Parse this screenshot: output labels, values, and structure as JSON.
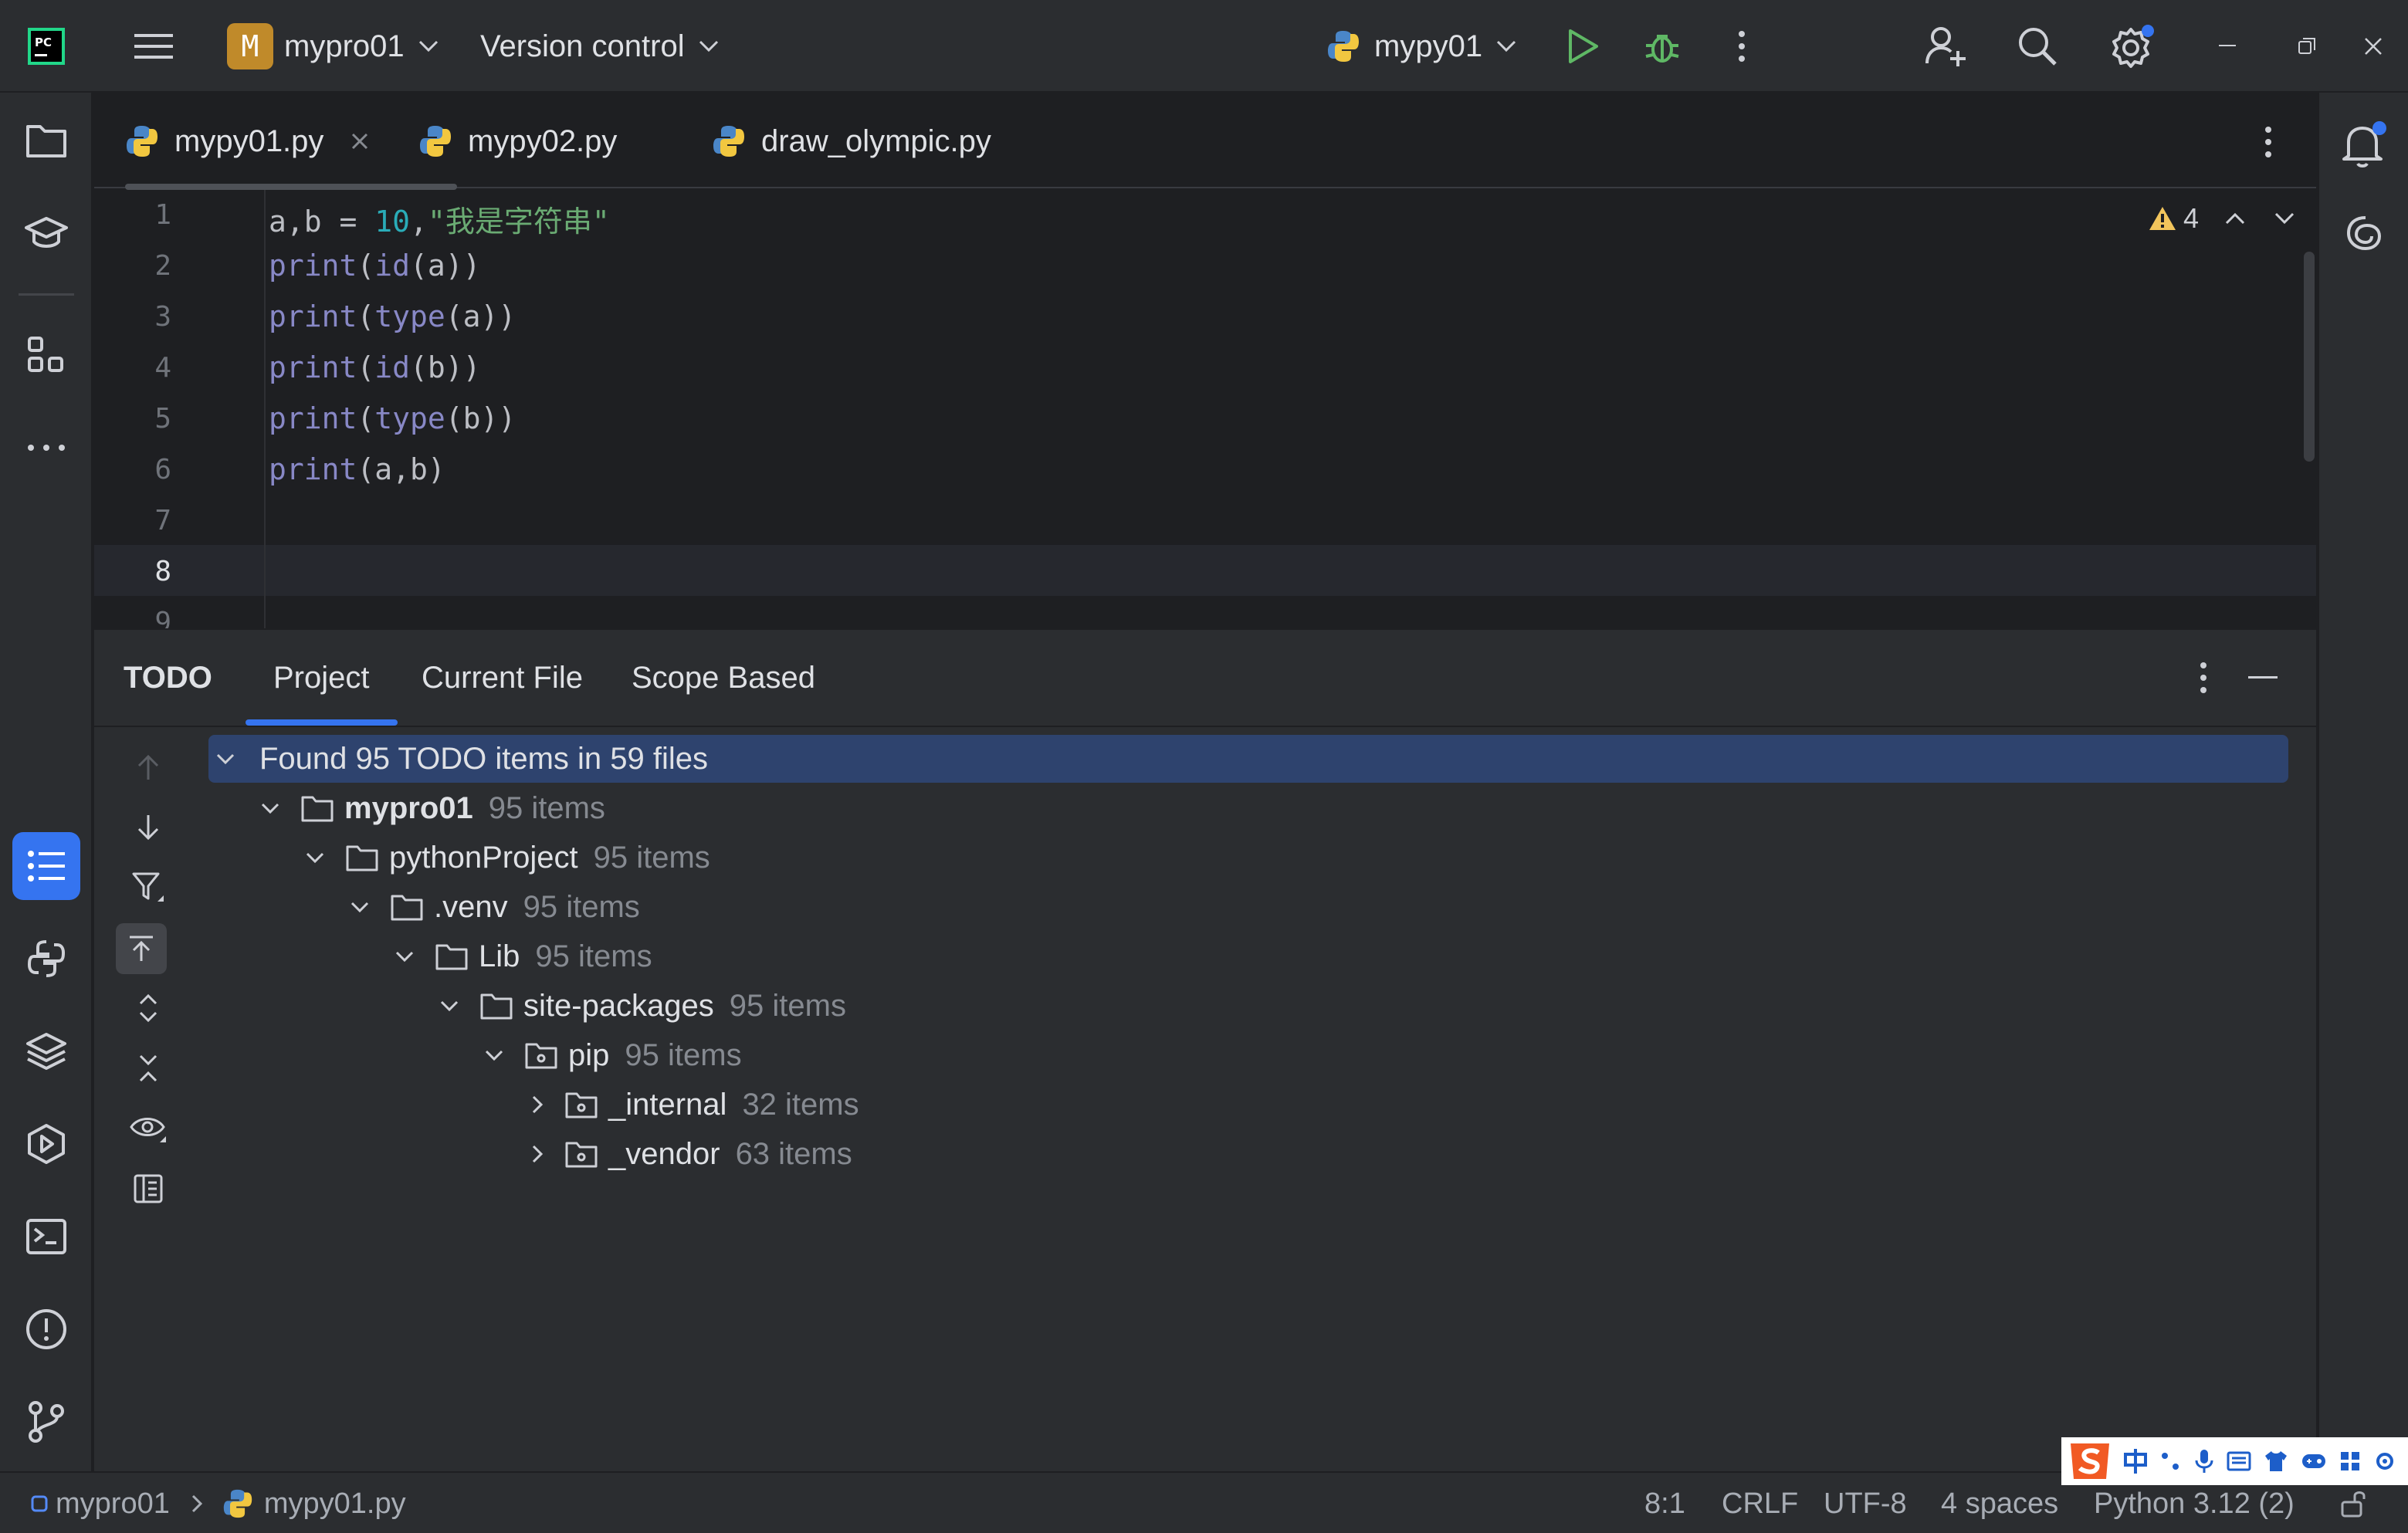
{
  "titlebar": {
    "project_initial": "M",
    "project_name": "mypro01",
    "vcs_label": "Version control",
    "run_config": "mypy01"
  },
  "tabs": [
    {
      "label": "mypy01.py"
    },
    {
      "label": "mypy02.py"
    },
    {
      "label": "draw_olympic.py"
    }
  ],
  "editor": {
    "line_numbers": [
      "1",
      "2",
      "3",
      "4",
      "5",
      "6",
      "7",
      "8",
      "9"
    ],
    "warning_count": "4",
    "code": {
      "l1_a": "a,b = ",
      "l1_num": "10",
      "l1_comma": ",",
      "l1_str": "\"我是字符串\"",
      "print": "print",
      "id": "id",
      "type": "type",
      "l2_rest": "(a))",
      "l3_rest": "(a))",
      "l4_rest": "(b))",
      "l5_rest": "(b))",
      "l6_rest": "(a,b)",
      "open": "("
    }
  },
  "todo": {
    "title": "TODO",
    "tabs": [
      "Project",
      "Current File",
      "Scope Based"
    ],
    "summary": "Found 95 TODO items in 59 files",
    "tree": [
      {
        "name": "mypro01",
        "count": "95 items"
      },
      {
        "name": "pythonProject",
        "count": "95 items"
      },
      {
        "name": ".venv",
        "count": "95 items"
      },
      {
        "name": "Lib",
        "count": "95 items"
      },
      {
        "name": "site-packages",
        "count": "95 items"
      },
      {
        "name": "pip",
        "count": "95 items"
      },
      {
        "name": "_internal",
        "count": "32 items"
      },
      {
        "name": "_vendor",
        "count": "63 items"
      }
    ]
  },
  "statusbar": {
    "breadcrumb_project": "mypro01",
    "breadcrumb_file": "mypy01.py",
    "position": "8:1",
    "line_ending": "CRLF",
    "encoding": "UTF-8",
    "indent": "4 spaces",
    "interpreter": "Python 3.12 (2)"
  },
  "colors": {
    "accent": "#3574f0",
    "background": "#1e1f22",
    "panel": "#2b2d30",
    "selected_row": "#2e436e"
  }
}
